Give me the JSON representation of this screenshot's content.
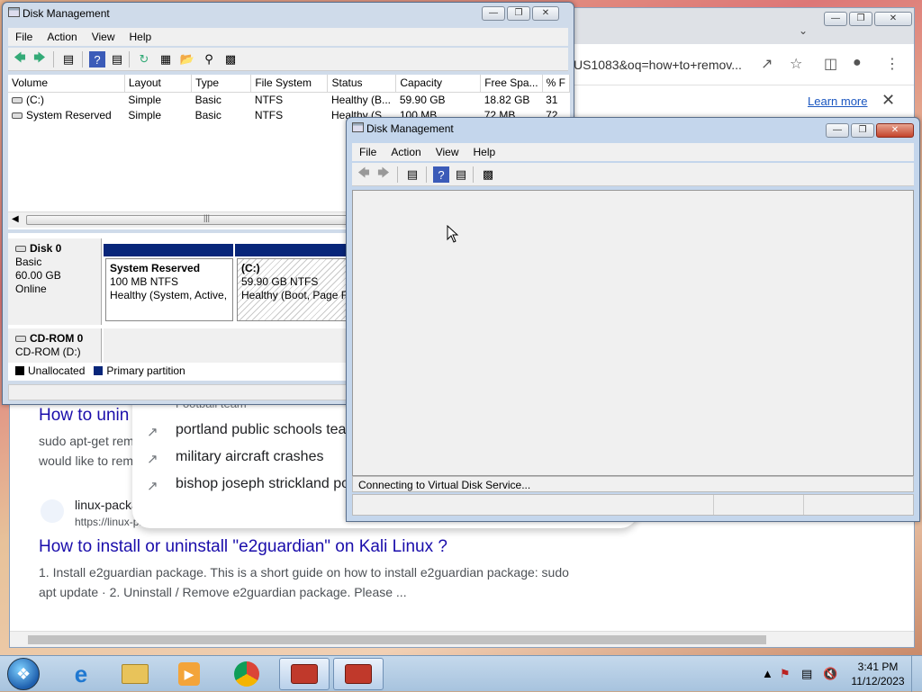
{
  "browser": {
    "url": "US1083&oq=how+to+remov...",
    "infobar_link": "Learn more",
    "results": [
      {
        "title": "How to unin",
        "snippet_html_lines": [
          "sudo apt-get rem",
          "would like to rem"
        ]
      },
      {
        "site_name": "linux-packa",
        "site_url": "https://linux-pa",
        "title": "How to install or uninstall \"e2guardian\" on Kali Linux ?",
        "snippet_lines": [
          "1. Install e2guardian package. This is a short guide on how to install e2guardian package: sudo",
          "apt update · 2. Uninstall / Remove e2guardian package. Please ..."
        ]
      }
    ],
    "suggestions_header_sub": "Football team",
    "suggestions": [
      "portland public schools tea",
      "military aircraft crashes",
      "bishop joseph strickland po"
    ]
  },
  "dm_back": {
    "title": "Disk Management",
    "menu": [
      "File",
      "Action",
      "View",
      "Help"
    ],
    "columns": [
      "Volume",
      "Layout",
      "Type",
      "File System",
      "Status",
      "Capacity",
      "Free Spa...",
      "% F"
    ],
    "rows": [
      [
        "(C:)",
        "Simple",
        "Basic",
        "NTFS",
        "Healthy (B...",
        "59.90 GB",
        "18.82 GB",
        "31"
      ],
      [
        "System Reserved",
        "Simple",
        "Basic",
        "NTFS",
        "Healthy (S...",
        "100 MB",
        "72 MB",
        "72"
      ]
    ],
    "disk0": {
      "name": "Disk 0",
      "type": "Basic",
      "size": "60.00 GB",
      "state": "Online",
      "partitions": [
        {
          "name": "System Reserved",
          "size": "100 MB NTFS",
          "status": "Healthy (System, Active,"
        },
        {
          "name": "(C:)",
          "size": "59.90 GB NTFS",
          "status": "Healthy (Boot, Page Fi"
        }
      ]
    },
    "cdrom": {
      "name": "CD-ROM 0",
      "drive": "CD-ROM (D:)"
    },
    "legend": [
      "Unallocated",
      "Primary partition"
    ],
    "colors": {
      "unallocated": "#000000",
      "primary": "#08267a"
    }
  },
  "dm_front": {
    "title": "Disk Management",
    "menu": [
      "File",
      "Action",
      "View",
      "Help"
    ],
    "status": "Connecting to Virtual Disk Service..."
  },
  "taskbar": {
    "time": "3:41 PM",
    "date": "11/12/2023"
  }
}
